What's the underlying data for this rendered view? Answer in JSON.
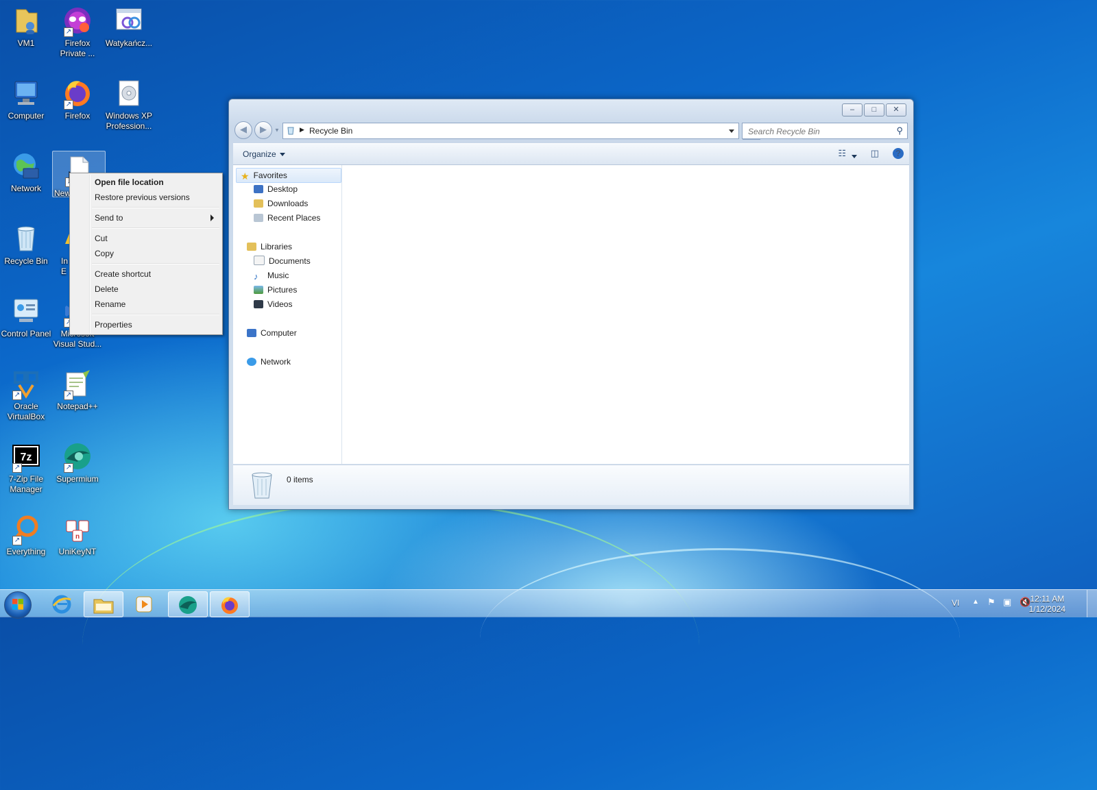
{
  "desktop": {
    "icons": [
      {
        "label": "VM1"
      },
      {
        "label": "Firefox\nPrivate ..."
      },
      {
        "label": "Watykańcz..."
      },
      {
        "label": "Computer"
      },
      {
        "label": "Firefox"
      },
      {
        "label": "Windows XP\nProfession..."
      },
      {
        "label": "Network"
      },
      {
        "label": "New"
      },
      {
        "label": "Recycle Bin"
      },
      {
        "label": "In\nE"
      },
      {
        "label": "Control Panel"
      },
      {
        "label": "Microsoft\nVisual Stud..."
      },
      {
        "label": "Oracle\nVirtualBox"
      },
      {
        "label": "Notepad++"
      },
      {
        "label": "7-Zip File\nManager"
      },
      {
        "label": "Supermium"
      },
      {
        "label": "Everything"
      },
      {
        "label": "UniKeyNT"
      }
    ]
  },
  "context_menu": {
    "items": [
      {
        "label": "Open file location"
      },
      {
        "label": "Restore previous versions"
      },
      {
        "label": "Send to"
      },
      {
        "label": "Cut"
      },
      {
        "label": "Copy"
      },
      {
        "label": "Create shortcut"
      },
      {
        "label": "Delete"
      },
      {
        "label": "Rename"
      },
      {
        "label": "Properties"
      }
    ]
  },
  "explorer": {
    "title_buttons": {
      "minimize": "–",
      "maximize": "□",
      "close": "✕"
    },
    "address": {
      "location": "Recycle Bin"
    },
    "search": {
      "placeholder": "Search Recycle Bin"
    },
    "command_bar": {
      "organize": "Organize"
    },
    "nav_pane": {
      "favorites": "Favorites",
      "desktop": "Desktop",
      "downloads": "Downloads",
      "recent_places": "Recent Places",
      "libraries": "Libraries",
      "documents": "Documents",
      "music": "Music",
      "pictures": "Pictures",
      "videos": "Videos",
      "computer": "Computer",
      "network": "Network"
    },
    "status": {
      "item_count": "0 items"
    }
  },
  "taskbar": {
    "language": "VI",
    "time": "12:11 AM",
    "date": "1/12/2024"
  }
}
